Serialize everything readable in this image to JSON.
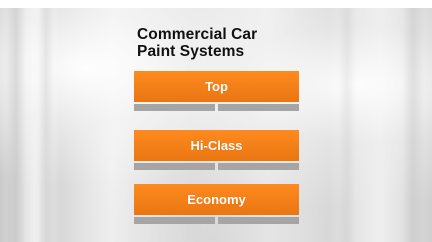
{
  "title": {
    "line1": "Commercial Car",
    "line2": "Paint Systems"
  },
  "menu": {
    "items": [
      {
        "label": "Top"
      },
      {
        "label": "Hi-Class"
      },
      {
        "label": "Economy"
      }
    ]
  },
  "colors": {
    "accent": "#f27f17",
    "divider": "#a5a5a5",
    "title_text": "#111111"
  }
}
